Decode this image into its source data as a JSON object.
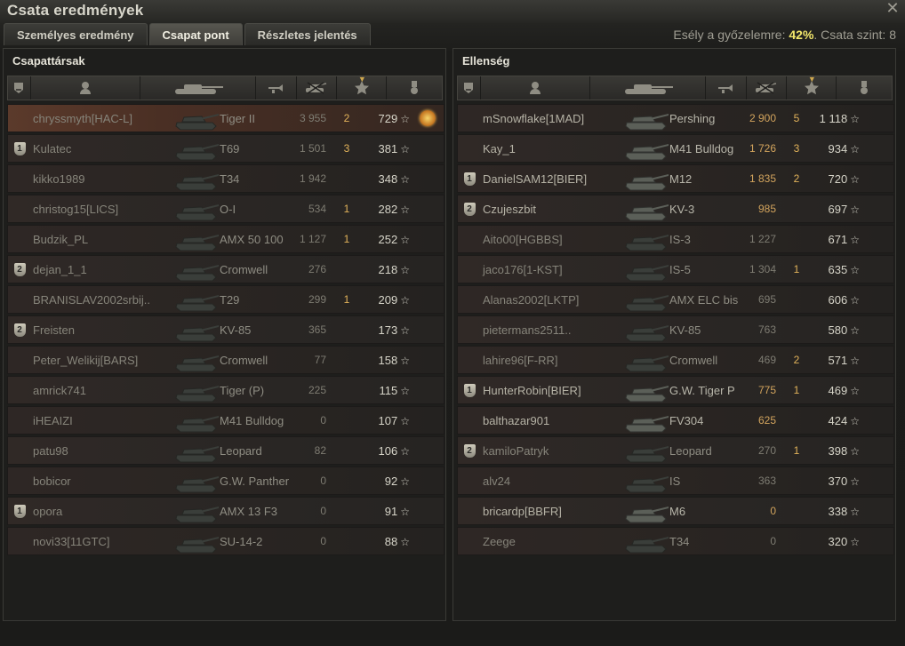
{
  "window": {
    "title": "Csata eredmények"
  },
  "tabs": [
    {
      "label": "Személyes eredmény",
      "active": false
    },
    {
      "label": "Csapat pont",
      "active": true
    },
    {
      "label": "Részletes jelentés",
      "active": false
    }
  ],
  "win_chance": {
    "prefix": "Esély a győzelemre:",
    "value": "42%",
    "suffix": ". Csata szint: 8"
  },
  "panels": {
    "allies": {
      "title": "Csapattársak",
      "rows": [
        {
          "rank": "",
          "name": "chryssmyth[HAC-L]",
          "tank": "Tiger II",
          "damage": "3 955",
          "kills": "2",
          "xp": "729",
          "medal": true,
          "highlight": true,
          "dead": true
        },
        {
          "rank": "1",
          "name": "Kulatec",
          "tank": "T69",
          "damage": "1 501",
          "kills": "3",
          "xp": "381",
          "dead": true
        },
        {
          "rank": "",
          "name": "kikko1989",
          "tank": "T34",
          "damage": "1 942",
          "kills": "",
          "xp": "348",
          "dead": true
        },
        {
          "rank": "",
          "name": "christog15[LICS]",
          "tank": "O-I",
          "damage": "534",
          "kills": "1",
          "xp": "282",
          "dead": true
        },
        {
          "rank": "",
          "name": "Budzik_PL",
          "tank": "AMX 50 100",
          "damage": "1 127",
          "kills": "1",
          "xp": "252",
          "dead": true
        },
        {
          "rank": "2",
          "name": "dejan_1_1",
          "tank": "Cromwell",
          "damage": "276",
          "kills": "",
          "xp": "218",
          "dead": true
        },
        {
          "rank": "",
          "name": "BRANISLAV2002srbij..",
          "tank": "T29",
          "damage": "299",
          "kills": "1",
          "xp": "209",
          "dead": true
        },
        {
          "rank": "2",
          "name": "Freisten",
          "tank": "KV-85",
          "damage": "365",
          "kills": "",
          "xp": "173",
          "dead": true
        },
        {
          "rank": "",
          "name": "Peter_Welikij[BARS]",
          "tank": "Cromwell",
          "damage": "77",
          "kills": "",
          "xp": "158",
          "dead": true
        },
        {
          "rank": "",
          "name": "amrick741",
          "tank": "Tiger (P)",
          "damage": "225",
          "kills": "",
          "xp": "115",
          "dead": true
        },
        {
          "rank": "",
          "name": "iHEAIZI",
          "tank": "M41 Bulldog",
          "damage": "0",
          "kills": "",
          "xp": "107",
          "dead": true
        },
        {
          "rank": "",
          "name": "patu98",
          "tank": "Leopard",
          "damage": "82",
          "kills": "",
          "xp": "106",
          "dead": true
        },
        {
          "rank": "",
          "name": "bobicor",
          "tank": "G.W. Panther",
          "damage": "0",
          "kills": "",
          "xp": "92",
          "dead": true
        },
        {
          "rank": "1",
          "name": "opora",
          "tank": "AMX 13 F3",
          "damage": "0",
          "kills": "",
          "xp": "91",
          "dead": true
        },
        {
          "rank": "",
          "name": "novi33[11GTC]",
          "tank": "SU-14-2",
          "damage": "0",
          "kills": "",
          "xp": "88",
          "dead": true
        }
      ]
    },
    "enemies": {
      "title": "Ellenség",
      "rows": [
        {
          "rank": "",
          "name": "mSnowflake[1MAD]",
          "tank": "Pershing",
          "damage": "2 900",
          "kills": "5",
          "xp": "1 118",
          "dmg_hi": true
        },
        {
          "rank": "",
          "name": "Kay_1",
          "tank": "M41 Bulldog",
          "damage": "1 726",
          "kills": "3",
          "xp": "934",
          "dmg_hi": true
        },
        {
          "rank": "1",
          "name": "DanielSAM12[BIER]",
          "tank": "M12",
          "damage": "1 835",
          "kills": "2",
          "xp": "720",
          "dmg_hi": true
        },
        {
          "rank": "2",
          "name": "Czujeszbit",
          "tank": "KV-3",
          "damage": "985",
          "kills": "",
          "xp": "697",
          "dmg_hi": true
        },
        {
          "rank": "",
          "name": "Aito00[HGBBS]",
          "tank": "IS-3",
          "damage": "1 227",
          "kills": "",
          "xp": "671",
          "dead": true
        },
        {
          "rank": "",
          "name": "jaco176[1-KST]",
          "tank": "IS-5",
          "damage": "1 304",
          "kills": "1",
          "xp": "635",
          "dead": true
        },
        {
          "rank": "",
          "name": "Alanas2002[LKTP]",
          "tank": "AMX ELC bis",
          "damage": "695",
          "kills": "",
          "xp": "606",
          "dead": true
        },
        {
          "rank": "",
          "name": "pietermans2511..",
          "tank": "KV-85",
          "damage": "763",
          "kills": "",
          "xp": "580",
          "dead": true
        },
        {
          "rank": "",
          "name": "lahire96[F-RR]",
          "tank": "Cromwell",
          "damage": "469",
          "kills": "2",
          "xp": "571",
          "dead": true
        },
        {
          "rank": "1",
          "name": "HunterRobin[BIER]",
          "tank": "G.W. Tiger P",
          "damage": "775",
          "kills": "1",
          "xp": "469",
          "dmg_hi": true
        },
        {
          "rank": "",
          "name": "balthazar901",
          "tank": "FV304",
          "damage": "625",
          "kills": "",
          "xp": "424",
          "dmg_hi": true
        },
        {
          "rank": "2",
          "name": "kamiloPatryk",
          "tank": "Leopard",
          "damage": "270",
          "kills": "1",
          "xp": "398",
          "dead": true
        },
        {
          "rank": "",
          "name": "alv24",
          "tank": "IS",
          "damage": "363",
          "kills": "",
          "xp": "370",
          "dead": true
        },
        {
          "rank": "",
          "name": "bricardp[BBFR]",
          "tank": "M6",
          "damage": "0",
          "kills": "",
          "xp": "338",
          "dmg_hi": true
        },
        {
          "rank": "",
          "name": "Zeege",
          "tank": "T34",
          "damage": "0",
          "kills": "",
          "xp": "320",
          "dead": true
        }
      ]
    }
  },
  "columns": {
    "icons": [
      "rank-icon",
      "player-icon",
      "tank-icon",
      "damage-icon",
      "kills-icon",
      "xp-star-icon",
      "medal-icon"
    ],
    "sorted_column": "xp-star-icon"
  },
  "colors": {
    "highlight_row": "#5b3a2b",
    "win_pct": "#f3e76b",
    "kills": "#e1b25a"
  }
}
